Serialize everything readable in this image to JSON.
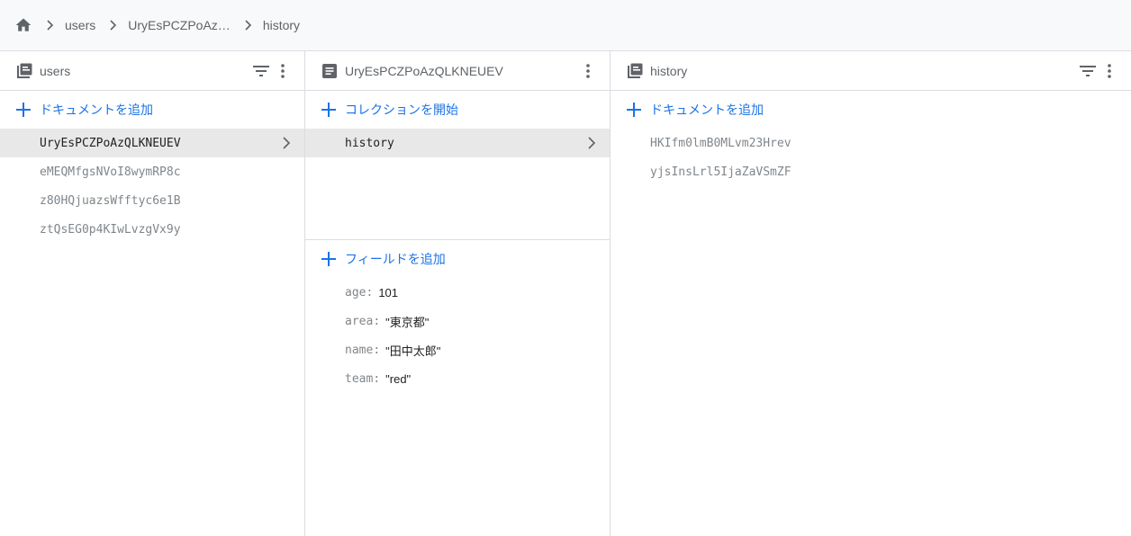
{
  "breadcrumb": {
    "items": [
      "users",
      "UryEsPCZPoAz…",
      "history"
    ]
  },
  "panels": {
    "users": {
      "title": "users",
      "add_label": "ドキュメントを追加",
      "documents": [
        {
          "id": "UryEsPCZPoAzQLKNEUEV",
          "selected": true
        },
        {
          "id": "eMEQMfgsNVoI8wymRP8c",
          "selected": false
        },
        {
          "id": "z80HQjuazsWfftyc6e1B",
          "selected": false
        },
        {
          "id": "ztQsEG0p4KIwLvzgVx9y",
          "selected": false
        }
      ]
    },
    "document": {
      "title": "UryEsPCZPoAzQLKNEUEV",
      "collection_add_label": "コレクションを開始",
      "collections": [
        "history"
      ],
      "field_add_label": "フィールドを追加",
      "fields": [
        {
          "key": "age",
          "value": "101"
        },
        {
          "key": "area",
          "value": "\"東京都\""
        },
        {
          "key": "name",
          "value": "\"田中太郎\""
        },
        {
          "key": "team",
          "value": "\"red\""
        }
      ]
    },
    "history": {
      "title": "history",
      "add_label": "ドキュメントを追加",
      "documents": [
        "HKIfm0lmB0MLvm23Hrev",
        "yjsInsLrl5IjaZaVSmZF"
      ]
    }
  },
  "colors": {
    "accent": "#1a73e8",
    "selected_row": "#e8e8e8",
    "icon": "#5f6368",
    "border": "#dadce0"
  },
  "icons": [
    "home-icon",
    "chevron-right-icon",
    "collection-icon",
    "document-icon",
    "filter-icon",
    "more-vert-icon",
    "plus-icon"
  ]
}
